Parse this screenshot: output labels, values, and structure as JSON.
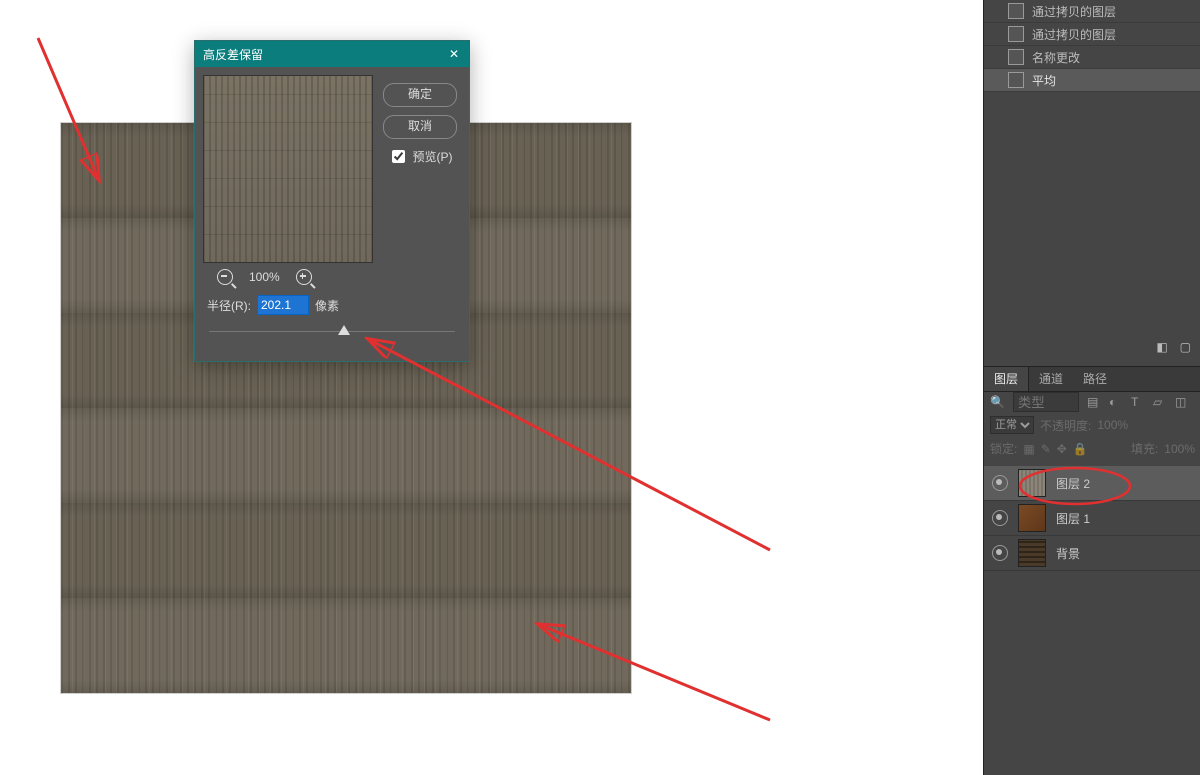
{
  "dialog": {
    "title": "高反差保留",
    "ok": "确定",
    "cancel": "取消",
    "preview_label": "预览(P)",
    "preview_checked": true,
    "zoom_pct": "100%",
    "radius_label": "半径(R):",
    "radius_value": "202.1",
    "radius_unit": "像素",
    "slider_pos_pct": 55
  },
  "history": {
    "items": [
      {
        "label": "通过拷贝的图层",
        "selected": false
      },
      {
        "label": "通过拷贝的图层",
        "selected": false
      },
      {
        "label": "名称更改",
        "selected": false
      },
      {
        "label": "平均",
        "selected": true
      }
    ]
  },
  "panel_tabs": {
    "layers": "图层",
    "channels": "通道",
    "paths": "路径"
  },
  "filter": {
    "placeholder": "类型"
  },
  "mode": {
    "value": "正常",
    "opacity_label": "不透明度:",
    "opacity_value": "100%"
  },
  "lock": {
    "label": "锁定:",
    "fill_label": "填充:",
    "fill_value": "100%"
  },
  "layers": [
    {
      "name": "图层 2",
      "thumb": "gray",
      "selected": true
    },
    {
      "name": "图层 1",
      "thumb": "brown",
      "selected": false
    },
    {
      "name": "背景",
      "thumb": "dark",
      "selected": false
    }
  ]
}
